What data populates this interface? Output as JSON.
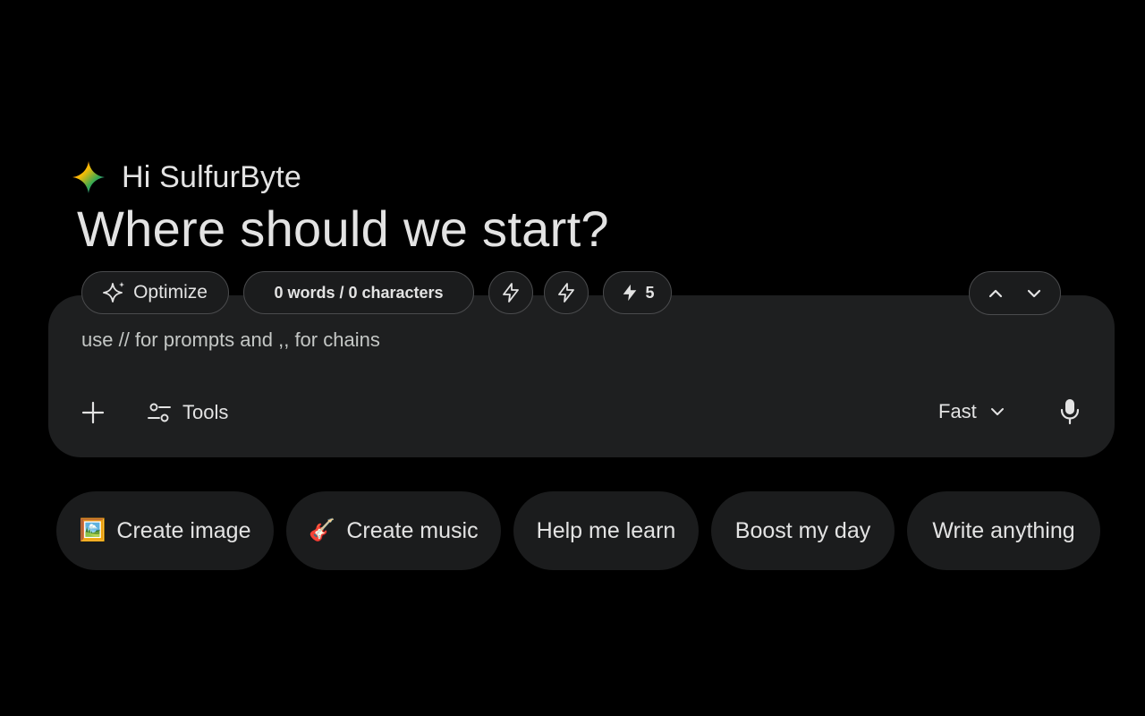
{
  "greeting": "Hi SulfurByte",
  "headline": "Where should we start?",
  "toolbar": {
    "optimize_label": "Optimize",
    "counter_label": "0 words / 0 characters",
    "bolt_count": "5"
  },
  "composer": {
    "placeholder": "use // for prompts and ,, for chains",
    "tools_label": "Tools",
    "mode_label": "Fast"
  },
  "suggestions": [
    {
      "icon": "🖼️",
      "label": "Create image"
    },
    {
      "icon": "🎸",
      "label": "Create music"
    },
    {
      "label": "Help me learn"
    },
    {
      "label": "Boost my day"
    },
    {
      "label": "Write anything"
    }
  ],
  "colors": {
    "background": "#000000",
    "surface": "#1e1f20",
    "chip": "#1b1c1d",
    "text": "#e3e3e3",
    "muted": "#c4c7c5"
  },
  "icons": {
    "logo": "gemini-spark-icon",
    "optimize": "sparkle-icon",
    "bolt": "lightning-bolt-icon",
    "nav_up": "chevron-up-icon",
    "nav_down": "chevron-down-icon",
    "plus": "plus-icon",
    "tools": "tune-icon",
    "mode": "chevron-down-icon",
    "mic": "microphone-icon"
  }
}
